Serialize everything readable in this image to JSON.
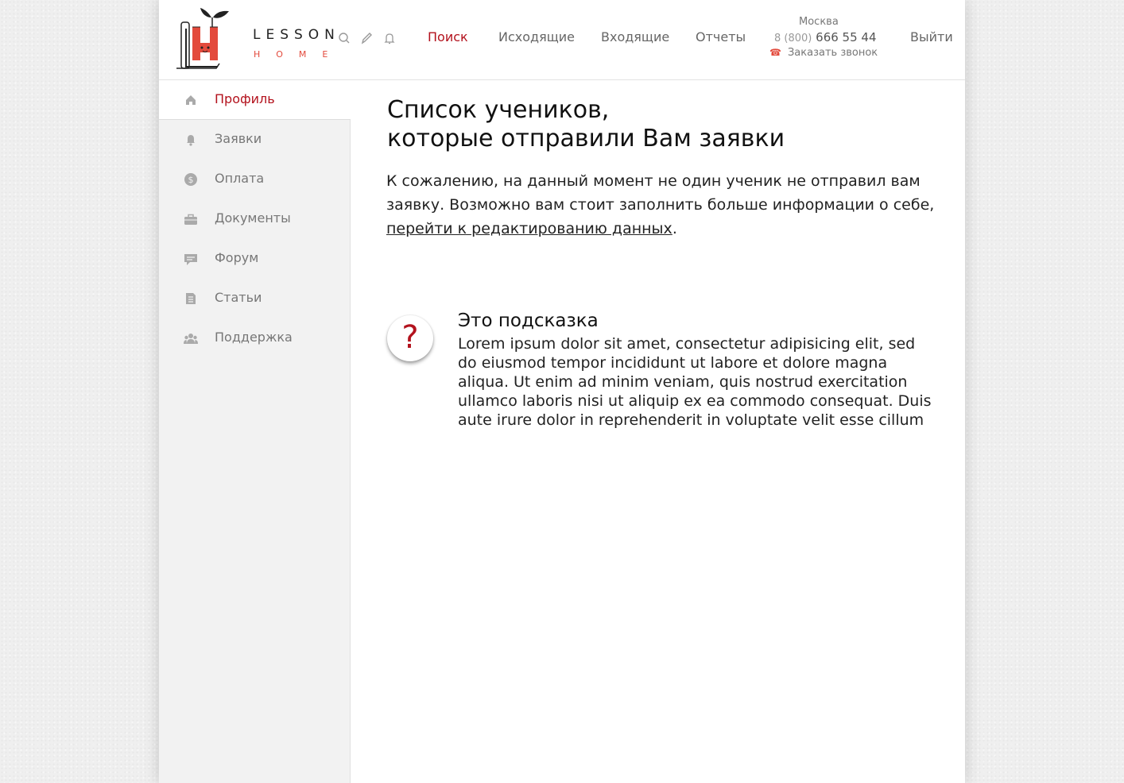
{
  "logo": {
    "word1": "LESSON",
    "word2": "HOME"
  },
  "header": {
    "icons": [
      "search-icon",
      "pencil-icon",
      "bell-icon"
    ],
    "nav": [
      {
        "label": "Поиск",
        "active": true
      },
      {
        "label": "Исходящие",
        "active": false
      },
      {
        "label": "Входящие",
        "active": false
      },
      {
        "label": "Отчеты",
        "active": false
      }
    ],
    "contact": {
      "city": "Москва",
      "phone_code": "8 (800)",
      "phone_number": "666 55 44",
      "callback_label": "Заказать звонок"
    },
    "logout_label": "Выйти"
  },
  "sidebar": {
    "items": [
      {
        "label": "Профиль",
        "icon": "home-icon",
        "active": true
      },
      {
        "label": "Заявки",
        "icon": "bell-icon",
        "active": false
      },
      {
        "label": "Оплата",
        "icon": "dollar-icon",
        "active": false
      },
      {
        "label": "Документы",
        "icon": "briefcase-icon",
        "active": false
      },
      {
        "label": "Форум",
        "icon": "chat-icon",
        "active": false
      },
      {
        "label": "Статьи",
        "icon": "document-icon",
        "active": false
      },
      {
        "label": "Поддержка",
        "icon": "users-icon",
        "active": false
      }
    ]
  },
  "main": {
    "title_line1": "Список учеников,",
    "title_line2": "которые отправили Вам заявки",
    "desc_text": "К сожалению, на данный момент не один ученик не отправил вам заявку. Возможно вам стоит заполнить больше информации о себе, ",
    "desc_link": "перейти к редактированию данных",
    "desc_end": ".",
    "hint": {
      "icon_glyph": "?",
      "title": "Это подсказка",
      "text": "Lorem ipsum dolor sit amet, consectetur adipisicing elit, sed do eiusmod tempor incididunt ut labore et dolore magna aliqua. Ut enim ad minim veniam, quis nostrud exercitation ullamco laboris nisi ut aliquip ex ea commodo consequat. Duis aute irure dolor in reprehenderit in voluptate velit esse cillum"
    }
  },
  "colors": {
    "accent": "#b3121d",
    "brand": "#e34a3c",
    "sidebar_bg": "#f2f2f2"
  }
}
